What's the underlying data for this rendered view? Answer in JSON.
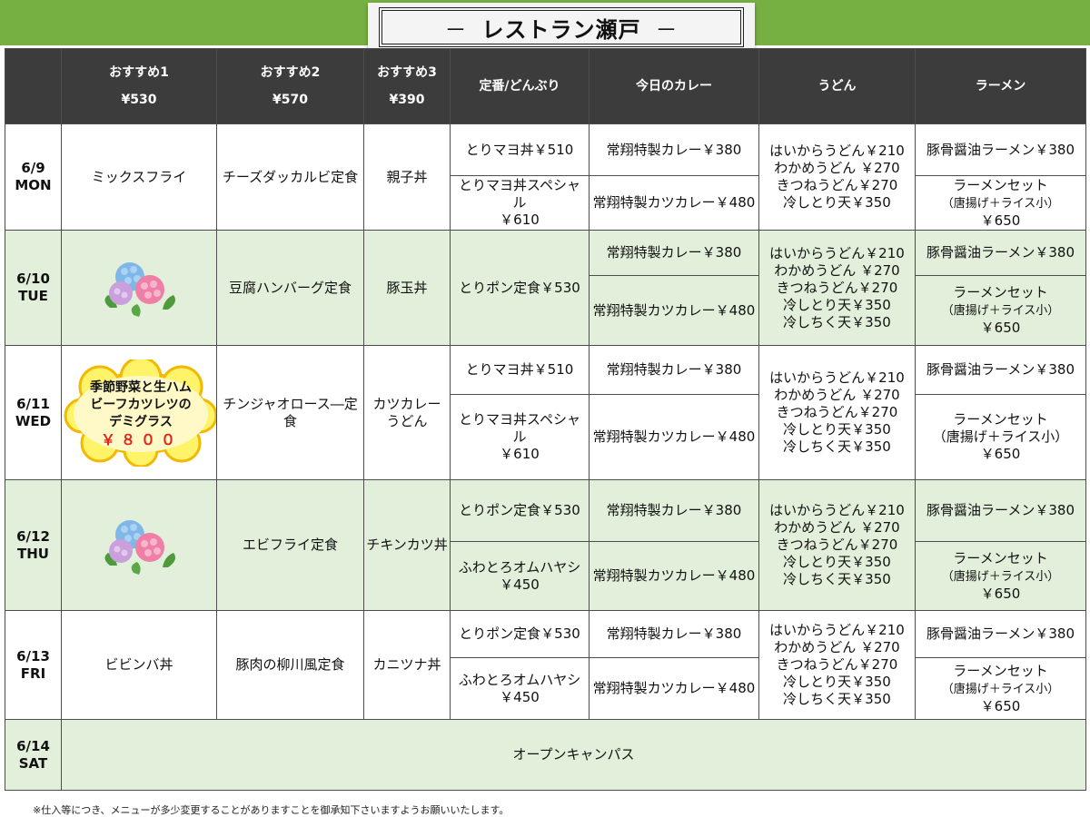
{
  "title": "レストラン瀬戸",
  "title_dash_left": "－",
  "title_dash_right": "－",
  "headers": {
    "osusume1": "おすすめ1",
    "osusume1_price": "¥530",
    "osusume2": "おすすめ2",
    "osusume2_price": "¥570",
    "osusume3": "おすすめ3",
    "osusume3_price": "¥390",
    "teiban": "定番/どんぶり",
    "curry": "今日のカレー",
    "udon": "うどん",
    "ramen": "ラーメン"
  },
  "days": [
    {
      "date": "6/9",
      "weekday": "MON",
      "o1": "ミックスフライ",
      "o2": "チーズダッカルビ定食",
      "o3": "親子丼",
      "teiban": [
        "とりマヨ丼￥510",
        "とりマヨ丼スペシャル",
        "￥610"
      ],
      "curry": [
        "常翔特製カレー￥380",
        "常翔特製カツカレー￥480"
      ],
      "udon": [
        "はいからうどん￥210",
        "わかめうどん ￥270",
        "きつねうどん￥270",
        "冷しとり天￥350"
      ],
      "ramen": [
        "豚骨醤油ラーメン￥380",
        "ラーメンセット",
        "（唐揚げ＋ライス小）",
        "￥650"
      ]
    },
    {
      "date": "6/10",
      "weekday": "TUE",
      "o1_icon": "hydrangea-icon",
      "o2": "豆腐ハンバーグ定食",
      "o3": "豚玉丼",
      "teiban": [
        "とりポン定食￥530"
      ],
      "curry": [
        "常翔特製カレー￥380",
        "常翔特製カツカレー￥480"
      ],
      "udon": [
        "はいからうどん￥210",
        "わかめうどん ￥270",
        "きつねうどん￥270",
        "冷しとり天￥350",
        "冷しちく天￥350"
      ],
      "ramen": [
        "豚骨醤油ラーメン￥380",
        "ラーメンセット",
        "（唐揚げ＋ライス小）",
        "￥650"
      ]
    },
    {
      "date": "6/11",
      "weekday": "WED",
      "o1_special": [
        "季節野菜と生ハム",
        "ビーフカツレツの",
        "デミグラス",
        "￥８００"
      ],
      "o2": "チンジャオロース―定食",
      "o3": [
        "カツカレー",
        "うどん"
      ],
      "teiban": [
        "とりマヨ丼￥510",
        "とりマヨ丼スペシャル",
        "￥610"
      ],
      "curry": [
        "常翔特製カレー￥380",
        "常翔特製カツカレー￥480"
      ],
      "udon": [
        "はいからうどん￥210",
        "わかめうどん ￥270",
        "きつねうどん￥270",
        "冷しとり天￥350",
        "冷しちく天￥350"
      ],
      "ramen": [
        "豚骨醤油ラーメン￥380",
        "ラーメンセット",
        "（唐揚げ＋ライス小）",
        "￥650"
      ]
    },
    {
      "date": "6/12",
      "weekday": "THU",
      "o1_icon": "hydrangea-icon",
      "o2": "エビフライ定食",
      "o3": "チキンカツ丼",
      "teiban": [
        "とりポン定食￥530",
        "ふわとろオムハヤシ",
        "￥450"
      ],
      "curry": [
        "常翔特製カレー￥380",
        "常翔特製カツカレー￥480"
      ],
      "udon": [
        "はいからうどん￥210",
        "わかめうどん ￥270",
        "きつねうどん￥270",
        "冷しとり天￥350",
        "冷しちく天￥350"
      ],
      "ramen": [
        "豚骨醤油ラーメン￥380",
        "ラーメンセット",
        "（唐揚げ＋ライス小）",
        "￥650"
      ]
    },
    {
      "date": "6/13",
      "weekday": "FRI",
      "o1": "ビビンバ丼",
      "o2": "豚肉の柳川風定食",
      "o3": "カニツナ丼",
      "teiban": [
        "とりポン定食￥530",
        "ふわとろオムハヤシ",
        "￥450"
      ],
      "curry": [
        "常翔特製カレー￥380",
        "常翔特製カツカレー￥480"
      ],
      "udon": [
        "はいからうどん￥210",
        "わかめうどん ￥270",
        "きつねうどん￥270",
        "冷しとり天￥350",
        "冷しちく天￥350"
      ],
      "ramen": [
        "豚骨醤油ラーメン￥380",
        "ラーメンセット",
        "（唐揚げ＋ライス小）",
        "￥650"
      ]
    },
    {
      "date": "6/14",
      "weekday": "SAT",
      "event": "オープンキャンパス"
    }
  ],
  "footnote": "※仕入等につき、メニューが多少変更することがありますことを御承知下さいますようお願いいたします。",
  "colors": {
    "band": "#76b043",
    "header": "#3c3c3c",
    "row_green": "#e2efda",
    "price_red": "#e0261a"
  }
}
